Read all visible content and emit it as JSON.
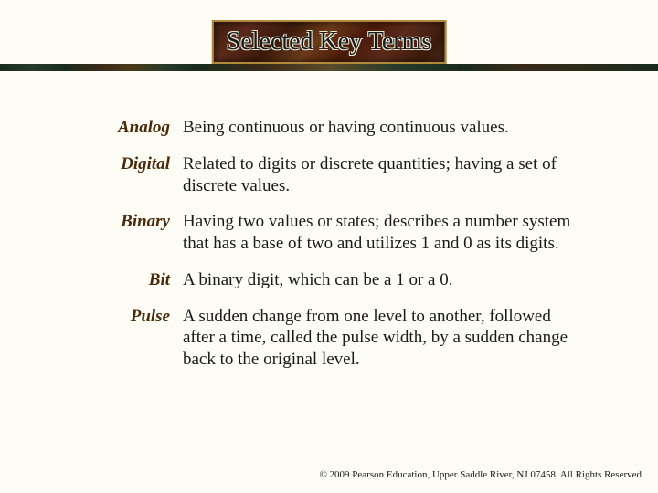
{
  "title": "Selected Key Terms",
  "terms": [
    {
      "label": "Analog",
      "definition": "Being continuous or having continuous values."
    },
    {
      "label": "Digital",
      "definition": "Related to digits or discrete quantities; having a set of discrete values."
    },
    {
      "label": "Binary",
      "definition": "Having two values or states; describes a number system that has a base of two and utilizes 1 and 0 as its digits."
    },
    {
      "label": "Bit",
      "definition": "A binary digit, which can be a 1 or a 0."
    },
    {
      "label": "Pulse",
      "definition": "A sudden change from one level to another, followed after a time, called the pulse width, by a sudden change back to the original level."
    }
  ],
  "footer": "© 2009 Pearson Education, Upper Saddle River, NJ 07458. All Rights Reserved"
}
